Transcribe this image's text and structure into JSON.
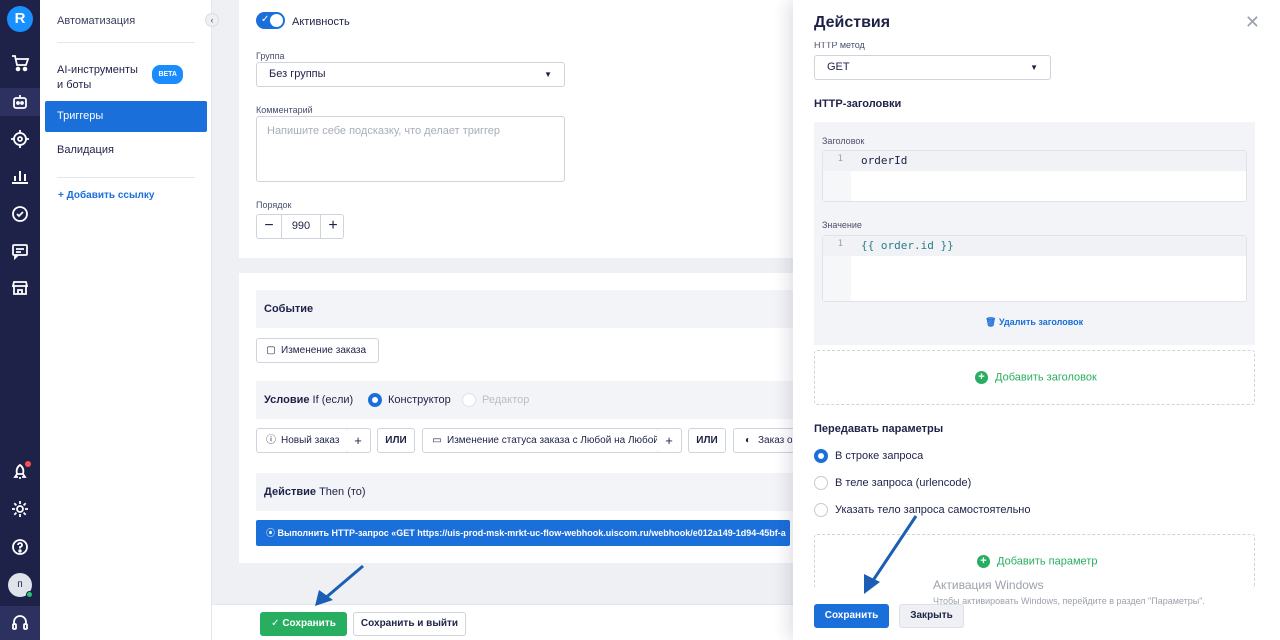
{
  "sidebar": {
    "section_title": "Автоматизация",
    "items": [
      {
        "label": "AI-инструменты и боты",
        "badge": "BETA"
      },
      {
        "label": "Триггеры"
      },
      {
        "label": "Валидация"
      }
    ],
    "add_link": "+ Добавить ссылку",
    "avatar_letter": "п"
  },
  "form": {
    "active_label": "Активность",
    "group_label": "Группа",
    "group_value": "Без группы",
    "comment_label": "Комментарий",
    "comment_placeholder": "Напишите себе подсказку, что делает триггер",
    "order_label": "Порядок",
    "order_value": "990"
  },
  "trigger": {
    "event_title": "Событие",
    "event_chip": "Изменение заказа",
    "condition_title": "Условие",
    "condition_if": "If (если)",
    "mode_constructor": "Конструктор",
    "mode_editor": "Редактор",
    "conditions": [
      "Новый заказ",
      "ИЛИ",
      "Изменение статуса заказа с Любой на Любой",
      "ИЛИ",
      "Заказ о"
    ],
    "action_title": "Действие",
    "action_then": "Then (то)",
    "action_text": "Выполнить HTTP-запрос «GET https://uis-prod-msk-mrkt-uc-flow-webhook.uiscom.ru/webhook/e012a149-1d94-45bf-a"
  },
  "footer": {
    "save": "Сохранить",
    "save_exit": "Сохранить и выйти"
  },
  "panel": {
    "title": "Действия",
    "method_label": "HTTP метод",
    "method_value": "GET",
    "headers_title": "HTTP-заголовки",
    "header_key_label": "Заголовок",
    "header_key_line": "1",
    "header_key_value": "orderId",
    "header_value_label": "Значение",
    "header_value_line": "1",
    "header_value_value": "{{ order.id }}",
    "delete_header": "Удалить заголовок",
    "add_header": "Добавить заголовок",
    "params_title": "Передавать параметры",
    "params_options": [
      "В строке запроса",
      "В теле запроса (urlencode)",
      "Указать тело запроса самостоятельно"
    ],
    "params_selected": 0,
    "add_param": "Добавить параметр",
    "save": "Сохранить",
    "close": "Закрыть"
  },
  "watermark": {
    "line1": "Активация Windows",
    "line2": "Чтобы активировать Windows, перейдите в раздел \"Параметры\"."
  },
  "colors": {
    "rail": "#1e2248",
    "accent": "#1a6fdb",
    "success": "#27ae60"
  },
  "icons": [
    "logo-icon",
    "cart-icon",
    "bot-icon",
    "target-icon",
    "chart-icon",
    "check-circle-icon",
    "chat-icon",
    "store-icon",
    "rocket-icon",
    "gear-icon",
    "help-icon",
    "headset-icon"
  ]
}
